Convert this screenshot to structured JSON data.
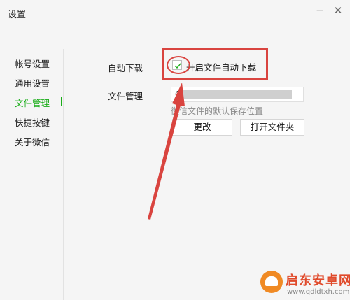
{
  "window": {
    "title": "设置",
    "minimize": "−",
    "close": "✕"
  },
  "sidebar": {
    "items": [
      {
        "label": "帐号设置",
        "active": false
      },
      {
        "label": "通用设置",
        "active": false
      },
      {
        "label": "文件管理",
        "active": true
      },
      {
        "label": "快捷按键",
        "active": false
      },
      {
        "label": "关于微信",
        "active": false
      }
    ]
  },
  "content": {
    "auto_download": {
      "label": "自动下载",
      "checkbox_label": "开启文件自动下载",
      "checked": true
    },
    "file_manage": {
      "label": "文件管理",
      "path_prefix": "C",
      "hint": "微信文件的默认保存位置",
      "change_button": "更改",
      "open_folder_button": "打开文件夹"
    }
  },
  "annotations": {
    "color": "#d9443f",
    "accent": "#1aad19"
  },
  "watermark": {
    "title": "启东安卓网",
    "url": "www.qdldtxh.com"
  }
}
